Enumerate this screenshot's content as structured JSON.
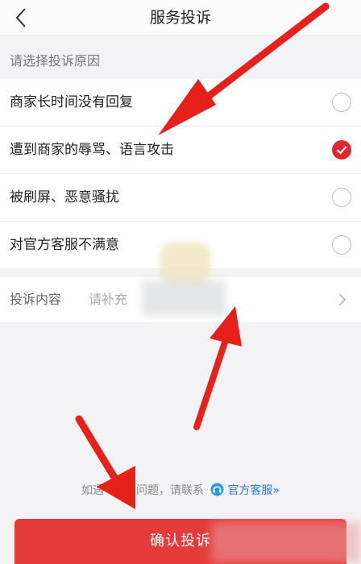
{
  "header": {
    "title": "服务投诉",
    "back_icon": "chevron-left-icon"
  },
  "section_title": "请选择投诉原因",
  "reasons": [
    {
      "label": "商家长时间没有回复",
      "selected": false
    },
    {
      "label": "遭到商家的辱骂、语言攻击",
      "selected": true
    },
    {
      "label": "被刷屏、恶意骚扰",
      "selected": false
    },
    {
      "label": "对官方客服不满意",
      "selected": false
    }
  ],
  "content": {
    "label": "投诉内容",
    "placeholder": "请补充"
  },
  "help": {
    "prefix": "如遇",
    "middle": "问题，请联系",
    "service": "官方客服»"
  },
  "confirm_button": "确认投诉",
  "colors": {
    "accent": "#e0282e",
    "button": "#e43a3a",
    "link": "#2a7bd6",
    "annotation_arrow": "#e8201c"
  }
}
